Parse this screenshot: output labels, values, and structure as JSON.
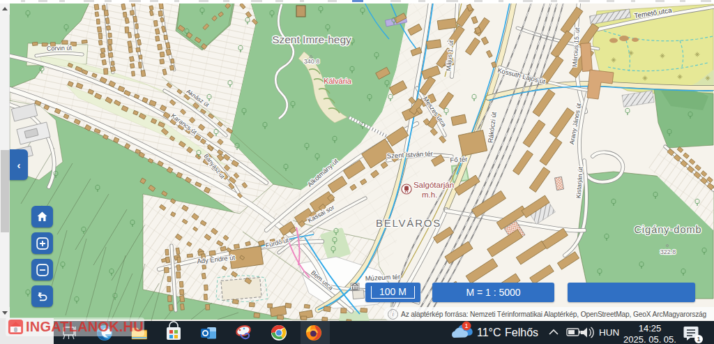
{
  "map": {
    "labels": {
      "corvin": "Corvin út",
      "karancs": "Karancs út",
      "aknasz": "Aknász út",
      "banyasz": "Bányász út",
      "ady_endre": "Ady Endre út",
      "furdo": "Fürdő út",
      "bem": "Bem utca",
      "alkotmany": "Alkotmány út",
      "kassai": "Kassai sor",
      "szent_imre": "Szent Imre-hegy",
      "elev_340": "340.8",
      "kalvaria": "Kálvária",
      "szent_istvan": "Szent István tér",
      "fo_ter": "Fő tér",
      "rakoczi": "Rákóczi út",
      "kossuth": "Kossuth Lajos út",
      "majus1": "Május 1. út",
      "meszes": "Meszes utca",
      "marcius15": "Március 15. út",
      "temeto": "Temető utca",
      "arany_janos": "Arany János út",
      "kistarjan": "Kistarján út",
      "belvaros": "BELVÁROS",
      "muzeum_ter": "Múzeum tér",
      "salgotarjan": "Salgótarján",
      "mh": "m.h.",
      "cigany_domb": "Cigány-domb",
      "elev_322": "322.8"
    },
    "colors": {
      "forest": "#93c793",
      "forest_dark": "#84bd85",
      "cemetery": "#e6e896",
      "urban": "#f6f3ec",
      "building": "#c9a36b",
      "building_salmon": "#d8a878",
      "road_major": "#f8f1d4",
      "route_blue": "#2fa9e8",
      "route_pink": "#ef86c0",
      "accent_blue": "#2e68b2",
      "scalebox_blue": "#3070c4"
    }
  },
  "panel": {
    "collapse_icon": "‹"
  },
  "controls": {
    "items": [
      {
        "icon": "home"
      },
      {
        "icon": "zoom-in"
      },
      {
        "icon": "zoom-out"
      },
      {
        "icon": "back"
      }
    ]
  },
  "scalebar": {
    "distance_label": "100 M",
    "ratio_label": "M = 1 : 5000"
  },
  "attribution": {
    "info_icon": "i",
    "text": "Az alaptérkép forrása: Nemzeti Térinformatikai Alaptérkép, OpenStreetMap, GeoX ArcMagyarország"
  },
  "watermark": {
    "text": "INGATLANOK.HU"
  },
  "taskbar": {
    "apps": [
      "task-view",
      "edge",
      "file-explorer",
      "microsoft-store",
      "outlook",
      "paint3d",
      "chrome",
      "firefox"
    ],
    "weather": {
      "temp": "11°C",
      "condition": "Felhős",
      "badge": "1"
    },
    "tray": {
      "language": "HUN",
      "time": "14:25",
      "date": "2025. 05. 05.",
      "notification_badge": "1"
    }
  }
}
